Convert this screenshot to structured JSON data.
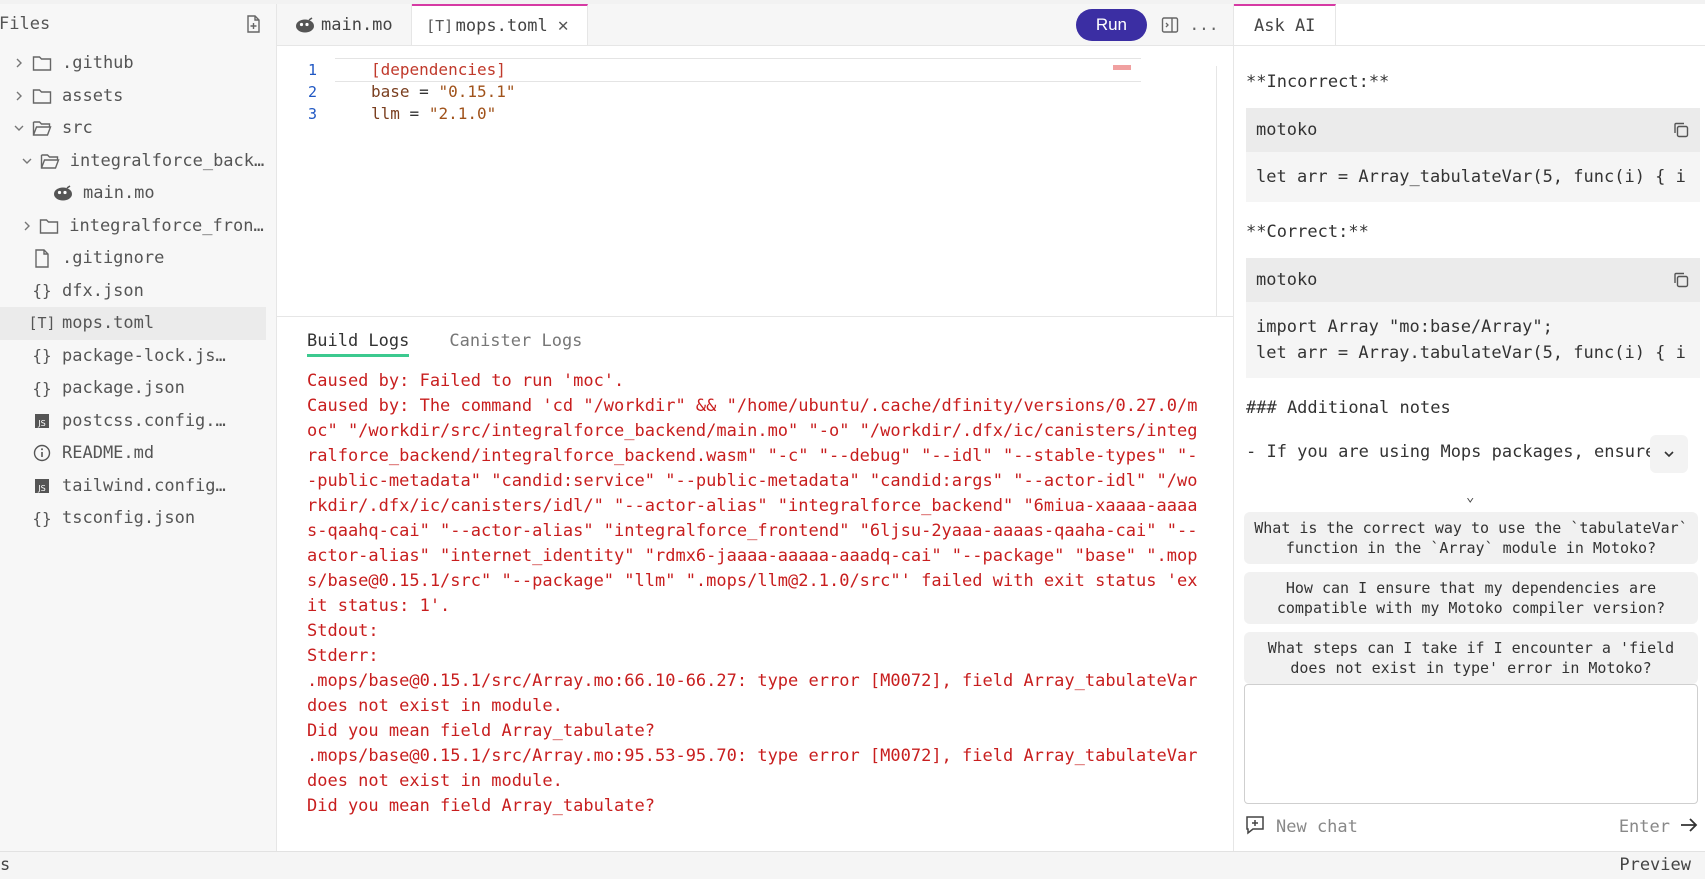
{
  "sidebar": {
    "title": "Files",
    "items": [
      {
        "label": ".github",
        "type": "folder",
        "chevron": "right"
      },
      {
        "label": "assets",
        "type": "folder",
        "chevron": "right"
      },
      {
        "label": "src",
        "type": "folder-open",
        "chevron": "down"
      },
      {
        "label": "integralforce_backend",
        "type": "folder-open",
        "chevron": "down"
      },
      {
        "label": "main.mo",
        "type": "motoko"
      },
      {
        "label": "integralforce_frontend",
        "type": "folder",
        "chevron": "right"
      },
      {
        "label": ".gitignore",
        "type": "file"
      },
      {
        "label": "dfx.json",
        "type": "json"
      },
      {
        "label": "mops.toml",
        "type": "toml"
      },
      {
        "label": "package-lock.js…",
        "type": "json"
      },
      {
        "label": "package.json",
        "type": "json"
      },
      {
        "label": "postcss.config.…",
        "type": "js"
      },
      {
        "label": "README.md",
        "type": "info"
      },
      {
        "label": "tailwind.config…",
        "type": "js"
      },
      {
        "label": "tsconfig.json",
        "type": "json"
      }
    ]
  },
  "editor": {
    "tabs": [
      {
        "label": "main.mo"
      },
      {
        "label": "mops.toml"
      }
    ],
    "run_label": "Run",
    "more_label": "...",
    "code": {
      "line_numbers": [
        "1",
        "2",
        "3"
      ],
      "l1": "[dependencies]",
      "l2_key": "base",
      "l2_eq": " = ",
      "l2_val": "\"0.15.1\"",
      "l3_key": "llm",
      "l3_eq": " = ",
      "l3_val": "\"2.1.0\""
    }
  },
  "logs": {
    "tabs": [
      "Build Logs",
      "Canister Logs"
    ],
    "text": "Caused by: Failed to run 'moc'.\nCaused by: The command 'cd \"/workdir\" && \"/home/ubuntu/.cache/dfinity/versions/0.27.0/moc\" \"/workdir/src/integralforce_backend/main.mo\" \"-o\" \"/workdir/.dfx/ic/canisters/integralforce_backend/integralforce_backend.wasm\" \"-c\" \"--debug\" \"--idl\" \"--stable-types\" \"--public-metadata\" \"candid:service\" \"--public-metadata\" \"candid:args\" \"--actor-idl\" \"/workdir/.dfx/ic/canisters/idl/\" \"--actor-alias\" \"integralforce_backend\" \"6miua-xaaaa-aaaas-qaahq-cai\" \"--actor-alias\" \"integralforce_frontend\" \"6ljsu-2yaaa-aaaas-qaaha-cai\" \"--actor-alias\" \"internet_identity\" \"rdmx6-jaaaa-aaaaa-aaadq-cai\" \"--package\" \"base\" \".mops/base@0.15.1/src\" \"--package\" \"llm\" \".mops/llm@2.1.0/src\"' failed with exit status 'exit status: 1'.\nStdout:\nStderr:\n.mops/base@0.15.1/src/Array.mo:66.10-66.27: type error [M0072], field Array_tabulateVar does not exist in module.\nDid you mean field Array_tabulate?\n.mops/base@0.15.1/src/Array.mo:95.53-95.70: type error [M0072], field Array_tabulateVar does not exist in module.\nDid you mean field Array_tabulate?"
  },
  "ai": {
    "tab": "Ask AI",
    "incorrect": "**Incorrect:**",
    "block1_lang": "motoko",
    "block1_code": "let arr = Array_tabulateVar(5, func(i) { i",
    "correct": "**Correct:**",
    "block2_lang": "motoko",
    "block2_line1": "import Array \"mo:base/Array\";",
    "block2_line2": "let arr = Array.tabulateVar(5, func(i) { i",
    "notes_heading": "### Additional notes",
    "notes_item": "- If you are using Mops packages, ensure",
    "suggestions": [
      "What is the correct way to use the `tabulateVar` function in the `Array` module in Motoko?",
      "How can I ensure that my dependencies are compatible with my Motoko compiler version?",
      "What steps can I take if I encounter a 'field does not exist in type' error in Motoko?"
    ],
    "new_chat": "New chat",
    "enter": "Enter"
  },
  "status": {
    "left": "s",
    "right": "Preview"
  },
  "colors": {
    "accent": "#3b2ea3",
    "tab_active": "#d63aa4",
    "log_error": "#c81e1e",
    "log_tab_underline": "#3cc98f"
  }
}
